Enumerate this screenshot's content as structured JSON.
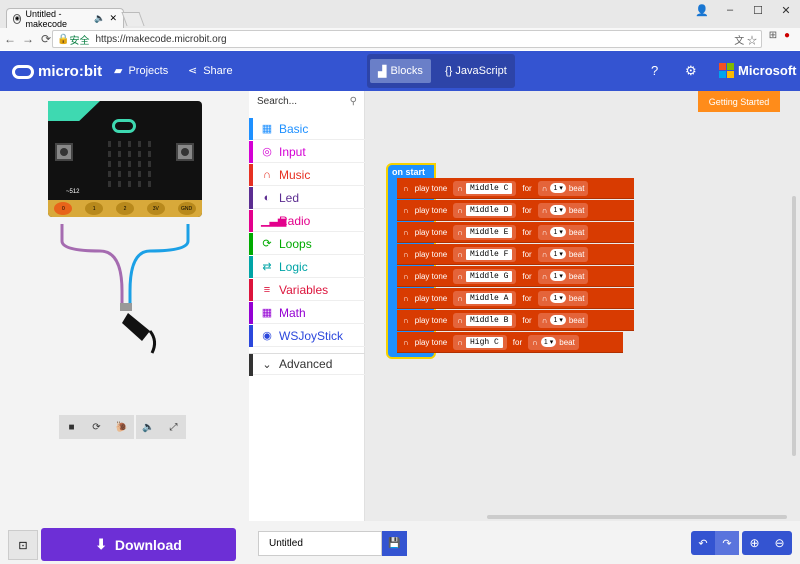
{
  "browser": {
    "tab_title": "Untitled - makecode",
    "window_controls": [
      "–",
      "☐",
      "✕"
    ],
    "secure_label": "安全",
    "url": "https://makecode.microbit.org"
  },
  "header": {
    "logo_text": "micro:bit",
    "projects_label": "Projects",
    "share_label": "Share",
    "blocks_label": "Blocks",
    "javascript_label": "{} JavaScript",
    "microsoft_label": "Microsoft"
  },
  "getting_started": "Getting Started",
  "toolbox": {
    "search_placeholder": "Search...",
    "categories": [
      {
        "label": "Basic",
        "color": "#1e90ff",
        "icon": "grid-icon"
      },
      {
        "label": "Input",
        "color": "#d400d4",
        "icon": "target-icon"
      },
      {
        "label": "Music",
        "color": "#e63022",
        "icon": "headphones-icon"
      },
      {
        "label": "Led",
        "color": "#5c2d91",
        "icon": "toggle-icon"
      },
      {
        "label": "Radio",
        "color": "#e3008c",
        "icon": "signal-icon"
      },
      {
        "label": "Loops",
        "color": "#00aa00",
        "icon": "refresh-icon"
      },
      {
        "label": "Logic",
        "color": "#00a4a6",
        "icon": "shuffle-icon"
      },
      {
        "label": "Variables",
        "color": "#dc143c",
        "icon": "list-icon"
      },
      {
        "label": "Math",
        "color": "#9400d3",
        "icon": "calculator-icon"
      },
      {
        "label": "WSJoyStick",
        "color": "#2b47dc",
        "icon": "gamepad-icon"
      }
    ],
    "advanced_label": "Advanced"
  },
  "simulator": {
    "pin_labels": [
      "0",
      "1",
      "2",
      "3V",
      "GND"
    ],
    "wire_label": "~512"
  },
  "workspace": {
    "on_start_label": "on start",
    "play_tone_label": "play tone",
    "for_label": "for",
    "beat_label": "beat",
    "rows": [
      {
        "note": "Middle C",
        "beats": "1"
      },
      {
        "note": "Middle D",
        "beats": "1"
      },
      {
        "note": "Middle E",
        "beats": "1"
      },
      {
        "note": "Middle F",
        "beats": "1"
      },
      {
        "note": "Middle G",
        "beats": "1"
      },
      {
        "note": "Middle A",
        "beats": "1"
      },
      {
        "note": "Middle B",
        "beats": "1"
      },
      {
        "note": "High C",
        "beats": "1"
      }
    ]
  },
  "footer": {
    "download_label": "Download",
    "filename": "Untitled"
  }
}
